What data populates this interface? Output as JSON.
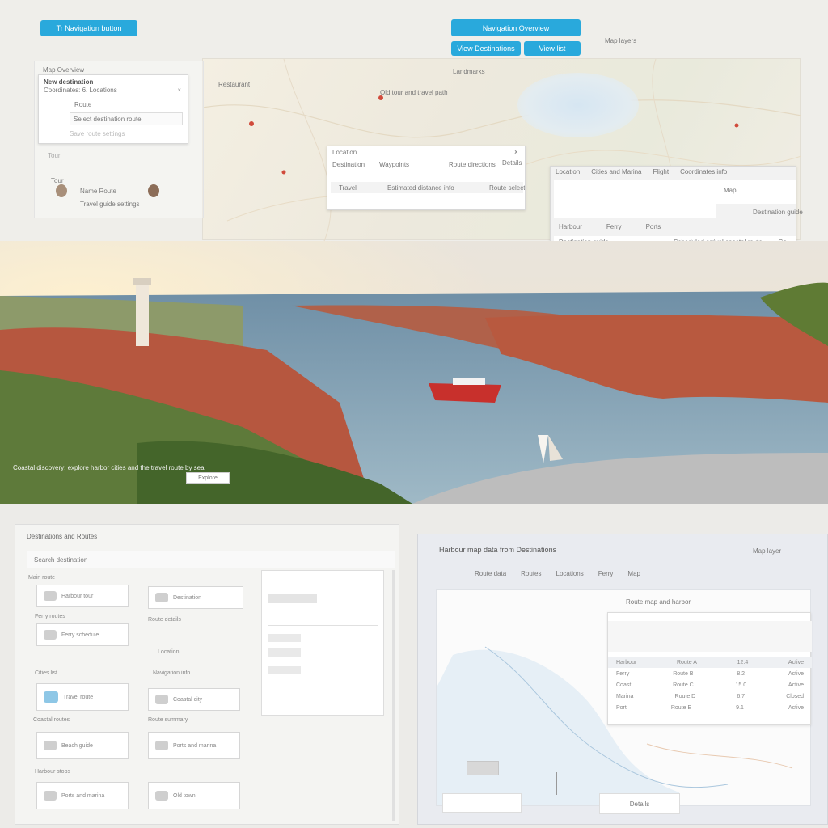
{
  "top_bar": {
    "left_tab": "Tr Navigation button",
    "blue_button": "Navigation Overview",
    "btn_left": "View Destinations",
    "btn_right": "View list",
    "right_caption": "Map layers"
  },
  "left_panel": {
    "header": "Map Overview",
    "title": "New destination",
    "subtitle": "Coordinates: 6. Locations",
    "field_label": "Route",
    "field_value": "Select destination route",
    "footer": "Save route settings",
    "section_label": "Tour",
    "user1_name": "Name Route",
    "user2_name": "Travel guide settings"
  },
  "center_popup": {
    "header": "Location",
    "close": "X",
    "col1": "Destination",
    "col2": "Waypoints",
    "col3": "Route directions",
    "col4": "Details",
    "row_label": "Travel",
    "row_value": "Estimated distance info",
    "row_value2": "Route select"
  },
  "right_popup": {
    "tabs": [
      "Location",
      "Cities and Marina",
      "Flight",
      "Coordinates info"
    ],
    "badge": "Map",
    "caption": "Destination guide",
    "row1": [
      "Harbour",
      "Ferry",
      "Ports"
    ],
    "row2_label": "Destination guide",
    "row2_value": "Scheduled arrival coastal route",
    "row2_end": "Go"
  },
  "map_labels": [
    "Restaurant",
    "Old tour and travel path",
    "Landmarks"
  ],
  "hero": {
    "caption": "Coastal discovery: explore harbor cities and the travel route by sea",
    "button": "Explore"
  },
  "bottom_left": {
    "title": "Destinations and Routes",
    "search": "Search destination",
    "sections": [
      "Main route",
      "Ferry routes",
      "Cities list",
      "Coastal routes",
      "Harbour stops"
    ],
    "tiles": [
      "Harbour tour",
      "Destination",
      "Ferry schedule",
      "Travel route",
      "Coastal city",
      "Beach guide",
      "Ports and marina",
      "Old town"
    ],
    "side_labels": [
      "Route details",
      "Location",
      "Navigation info",
      "Route summary"
    ]
  },
  "bottom_right": {
    "title": "Harbour map data from Destinations",
    "link": "Map layer",
    "tabs": [
      "Route data",
      "Routes",
      "Locations",
      "Ferry",
      "Map"
    ],
    "panel_header": "Route map and harbor",
    "table_rows": [
      [
        "Harbour",
        "Route A",
        "12.4",
        "Active"
      ],
      [
        "Ferry",
        "Route B",
        "8.2",
        "Active"
      ],
      [
        "Coast",
        "Route C",
        "15.0",
        "Active"
      ],
      [
        "Marina",
        "Route D",
        "6.7",
        "Closed"
      ],
      [
        "Port",
        "Route E",
        "9.1",
        "Active"
      ]
    ],
    "footer_btn": "Details"
  },
  "colors": {
    "accent": "#29a9dc",
    "water": "#8fb7c8",
    "roofs": "#b5533d",
    "ship": "#c8302c"
  }
}
